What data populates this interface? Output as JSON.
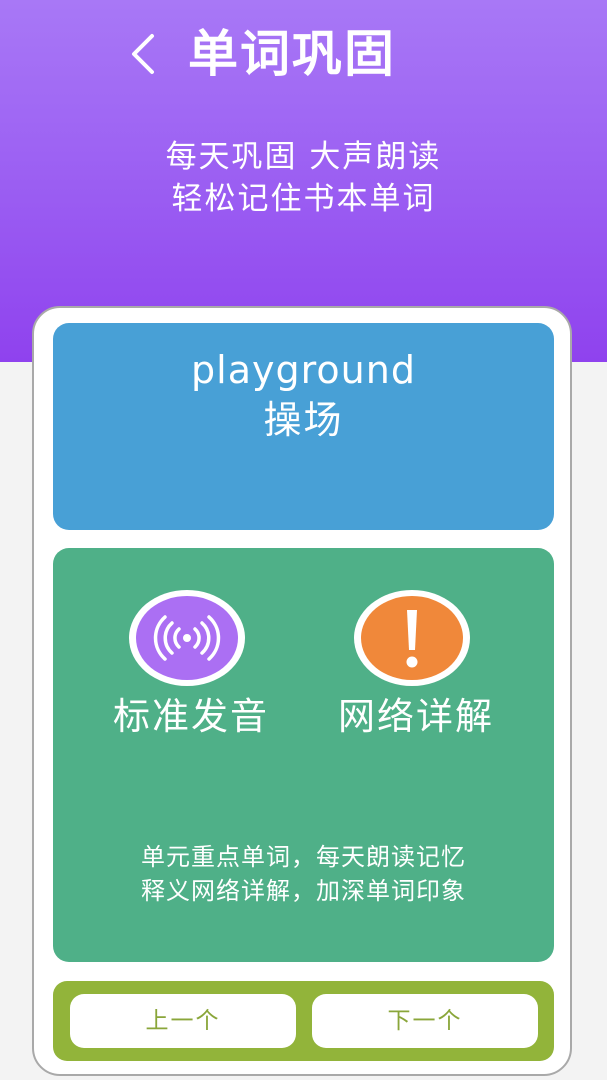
{
  "header": {
    "title": "单词巩固",
    "back_icon": "chevron-left-icon",
    "slogan_line1": "每天巩固 大声朗读",
    "slogan_line2": "轻松记住书本单词",
    "gradient_colors": [
      "#a878f6",
      "#8f42ee"
    ]
  },
  "word": {
    "english": "playground",
    "chinese": "操场",
    "panel_color": "#48a0d6"
  },
  "actions": {
    "panel_color": "#4fb088",
    "pronounce": {
      "label": "标准发音",
      "icon": "sound-wave-icon",
      "color": "#ab6ff3"
    },
    "details": {
      "label": "网络详解",
      "icon": "exclamation-icon",
      "color": "#f0883a"
    },
    "description_line1": "单元重点单词，每天朗读记忆",
    "description_line2": "释义网络详解，加深单词印象"
  },
  "navigation": {
    "panel_color": "#92b43a",
    "prev_label": "上一个",
    "next_label": "下一个"
  }
}
